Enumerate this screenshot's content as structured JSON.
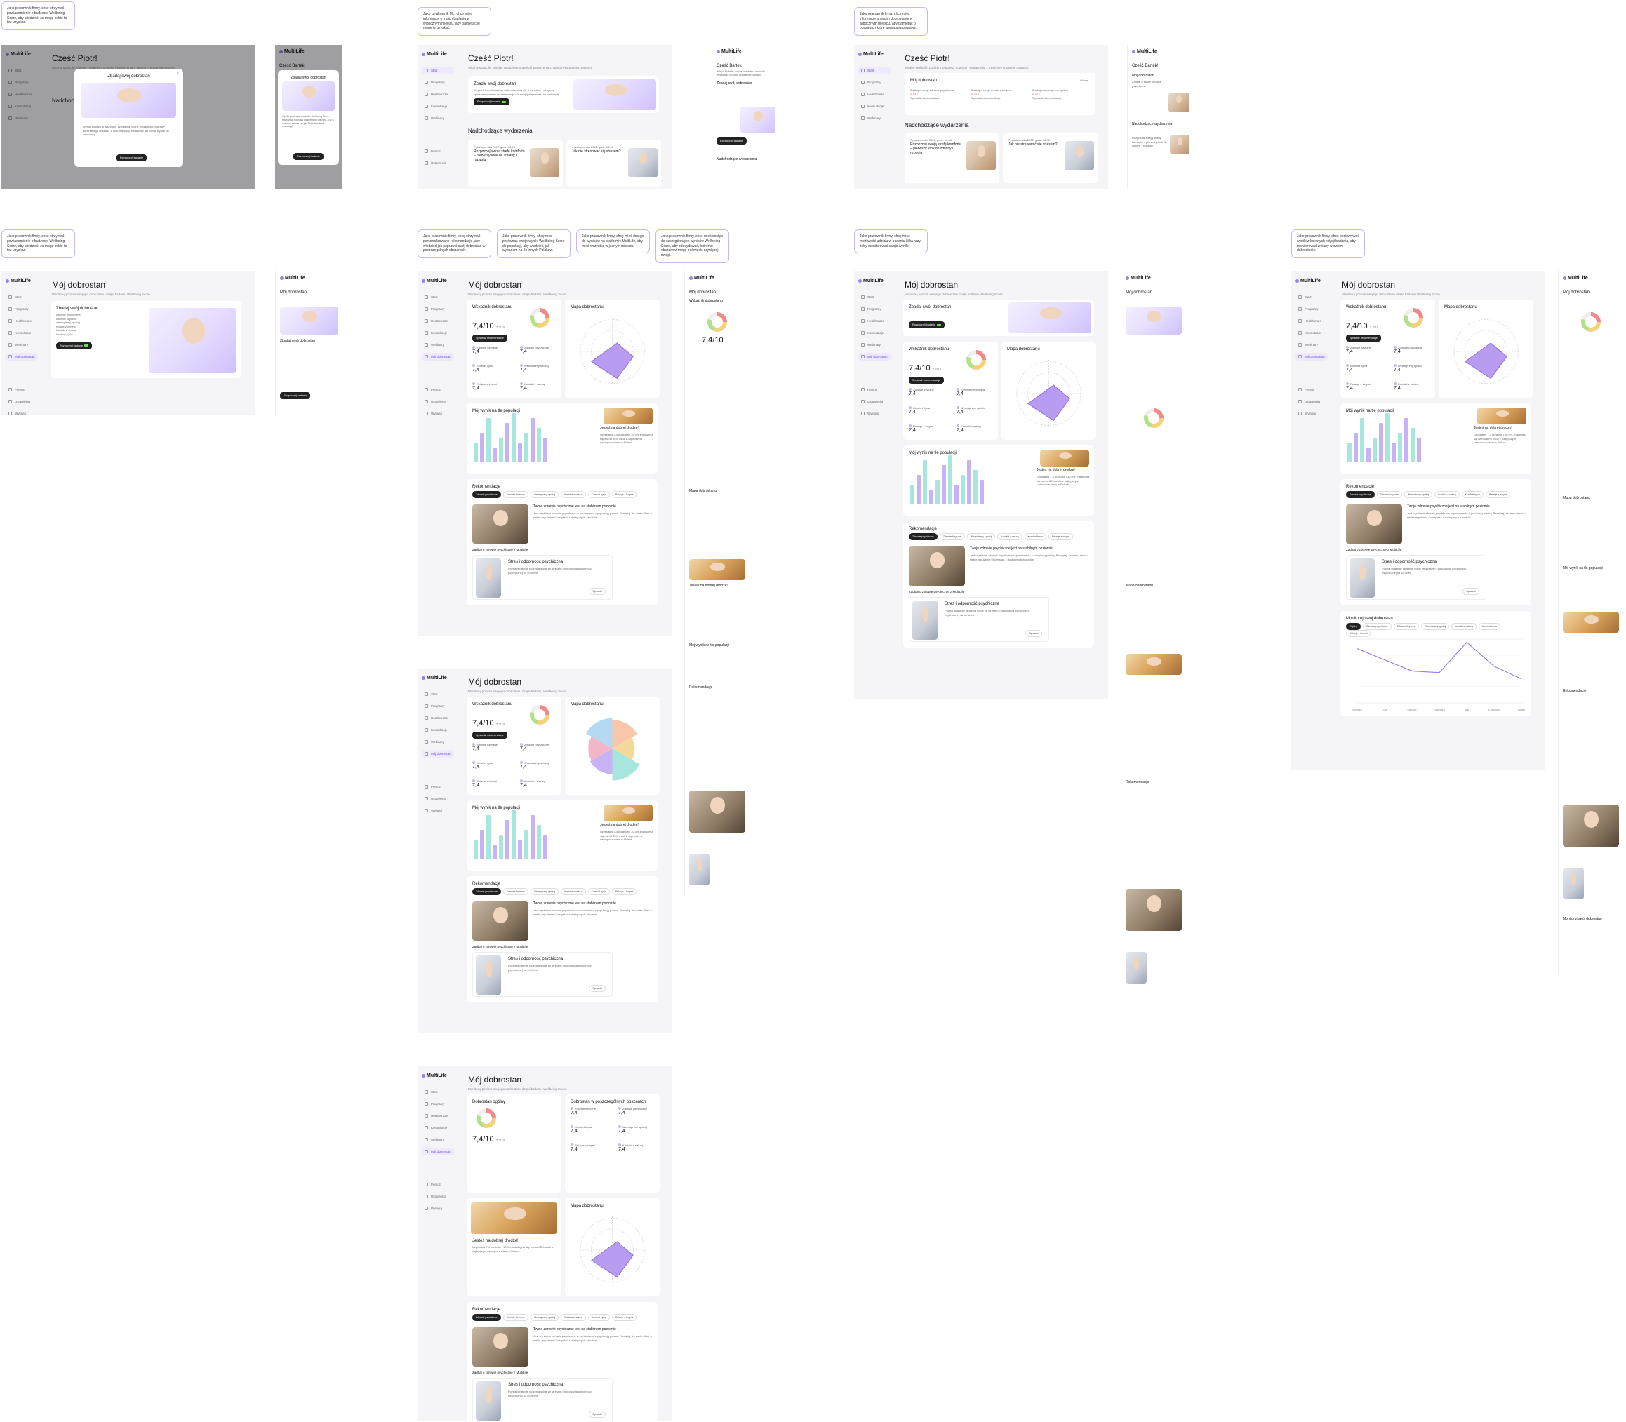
{
  "brand": {
    "name": "MultiLife",
    "accent": "#9b7fe8",
    "teal": "#a7e6dd",
    "lilac": "#c7b2f5"
  },
  "notes": [
    "Jako pracownik firmy, chcę otrzymać powiadomienie o budżecie Wellbeing Score, aby wiedzieć, że mogę sobie to też uzyskać.",
    "Jako użytkownik ML, chcę mieć informacje o moich badaniu w widocznym miejscu, aby pamiętać je mogę je uzyskać.",
    "Jako pracownik firmy, chcę mieć informacje o swoim dobrostanie w widocznym miejscu, aby pamiętać o obszarach które wymagają poprawy.",
    "Jako pracownik firmy, chcę otrzymać powiadomienie o budżecie Wellbeing Score, aby wiedzieć, że mogę sobie to też uzyskać.",
    "Jako pracownik firmy, chcę otrzymać personalizowane rekomendacje, aby wiedzieć jak poprawić swój dobrostan w poszczególnych obszarach.",
    "Jako pracownik firmy, chcę móc porównać swoje wyniki Wellbeing Score do populacji, aby wiedzieć, jak wypadam na tle innych Polaków.",
    "Jako pracownik firmy, chcę mieć dostęp do wyników na platformie MultiLife, aby mieć wszystko w jednym miejscu.",
    "Jako pracownik firmy, chcę mieć dostęp do szczegółowych wyników Wellbeing Score, aby zdecydować, któremu obszarowi mogę poświęcić najwięcej uwagi.",
    "Jako pracownik firmy, chcę mieć możliwość udziału w badaniu kilka razy, żeby monitorować swoje wyniki.",
    "Jako pracownik firmy, chcę porównywać wyniki z kolejnych edycji badania, aby monitorować zmiany w swoim dobrostanie."
  ],
  "nav": {
    "items": [
      "Start",
      "Programy",
      "Healthcraze",
      "Konsultacje",
      "Webinary",
      "Mój dobrostan"
    ],
    "bottom": [
      "Pomoc",
      "Ustawienia",
      "Wyloguj"
    ]
  },
  "home": {
    "greeting": "Cześć Piotr!",
    "greeting_b": "Cześć Bartek!",
    "sub": "Witaj w MultiLife, poniżej znajdziesz nowości i wydarzenia z Twoich Programów nowości.",
    "cta_title": "Zbadaj swój dobrostan",
    "cta_text": "Wypełnij kwestionariusz dobrostanu od ok. 6 minutach i otrzymaj spersonalizowane rekomendacje dla swojej aktywności na platformie.",
    "cta_button": "Rozpocznij badanie",
    "events_title": "Nadchodzące wydarzenia",
    "event1": "Rozpoznaj swoją strefę komfortu – pierwszy krok do zmiany i rozwoju",
    "event2": "Jak nie stresować się stresem?",
    "event_date": "7 października 2022, godz. 18:00",
    "wellbeing_title": "Mój dobrostan",
    "mini1": "Zadbaj o swoje zdrowie psychiczne",
    "mini2": "Zadbaj o swoje relacje z innymi",
    "mini3": "Zadbaj o wewnętrzny spokój",
    "mini_more": "Więcej",
    "mini_score": "6,3/10",
    "mini_link": "Sprawdź rekomendacje"
  },
  "modal": {
    "title": "Zbadaj swój dobrostan",
    "text": "Wyniki pokażą to wszystko. Wellbeing Score, możliwości poprawy konkretnego obszaru, a co 6 miesięcy zobaczysz jak Twoje wyniki się zmieniają.",
    "button": "Rozpocznij badanie"
  },
  "wellbeing": {
    "title": "Mój dobrostan",
    "sub": "Monitoruj poziom swojego dobrostanu dzięki badaniu Wellbeing Score.",
    "cta_title": "Zbadaj swój dobrostan",
    "cta_list": [
      "zdrowie psychiczne",
      "zdrowie fizyczne",
      "wewnętrzny spokój",
      "relacje z innymi",
      "kontakt z naturą",
      "komfort życia"
    ],
    "index_title": "Wskaźnik dobrostanu",
    "overall_title": "Dobrostan ogólny",
    "areas_title": "Dobrostan w poszczególnych obszarach",
    "score": "7,4/10",
    "score_prev": "7,2/10",
    "recheck": "Sprawdź rekomendacje",
    "map_title": "Mapa dobrostanu",
    "population_title": "Mój wynik na tle populacji",
    "good_path_title": "Jesteś na dobrej drodze!",
    "good_path_text": "Uzyskałeś 7,4 punktów i 10,0% znajdujesz się wśród 85% osób z najlepszym samopoczuciem w Polsce.",
    "reco_title": "Rekomendacje",
    "reco_chips": [
      "Zdrowie psychiczne",
      "Zdrowie fizyczne",
      "Wewnętrzny spokój",
      "Kontakt z naturą",
      "Komfort życia",
      "Relacje z innymi"
    ],
    "reco_card_title": "Twoje zdrowie psychiczne jest na stabilnym poziomie",
    "reco_card_text": "Jest wynikiem zdrowie psychiczne w porównaniu z populacją polską. Pamiętaj, że warto dbać o siebie regularnie i korzystać z dostępnych zasobów.",
    "care_label": "Zadbaj o zdrowie psychiczne z MultiLife",
    "stress_title": "Stres i odporność psychiczna",
    "stress_text": "Poznaj strategie radzenia sobie ze stresem i budowania odporności psychicznej na co dzień.",
    "stress_link": "Sprawdź",
    "monitor_title": "Monitoruj swój dobrostan",
    "monitor_chips": [
      "Ogólny",
      "Zdrowie psychiczne",
      "Zdrowie fizyczne",
      "Wewnętrzny spokój",
      "Kontakt z naturą",
      "Komfort życia",
      "Relacje z innymi"
    ],
    "months": [
      "Styczeń",
      "Luty",
      "Marzec",
      "Kwiecień",
      "Maj",
      "Czerwiec",
      "Lipiec"
    ],
    "metrics": [
      {
        "name": "Zdrowie fizyczne",
        "value": "7,4",
        "prev": "7,2"
      },
      {
        "name": "Zdrowie psychiczne",
        "value": "7,4",
        "prev": "7,2"
      },
      {
        "name": "Komfort życia",
        "value": "7,4",
        "prev": "7,2"
      },
      {
        "name": "Wewnętrzny spokój",
        "value": "7,4",
        "prev": "7,2"
      },
      {
        "name": "Relacje z innymi",
        "value": "7,4",
        "prev": "7,2"
      },
      {
        "name": "Kontakt z naturą",
        "value": "7,4",
        "prev": "7,2"
      }
    ]
  },
  "chart_data": [
    {
      "type": "bar",
      "categories": [
        "Zdrowie psychiczne",
        "Zdrowie fizyczne",
        "Komfort życia",
        "Wewnętrzny spokój",
        "Relacje z innymi",
        "Kontakt z naturą"
      ],
      "series": [
        {
          "name": "",
          "values": [
            4,
            9,
            5,
            10,
            6,
            7
          ]
        },
        {
          "name": "",
          "values": [
            6,
            3,
            8,
            4,
            9,
            5
          ]
        }
      ]
    },
    {
      "type": "line",
      "categories": [
        "Styczeń",
        "Luty",
        "Marzec",
        "Kwiecień",
        "Maj",
        "Czerwiec",
        "Lipiec"
      ],
      "series": [
        {
          "name": "",
          "values": [
            6.8,
            5.4,
            4.0,
            3.8,
            7.6,
            4.6,
            3.0
          ]
        }
      ]
    }
  ]
}
